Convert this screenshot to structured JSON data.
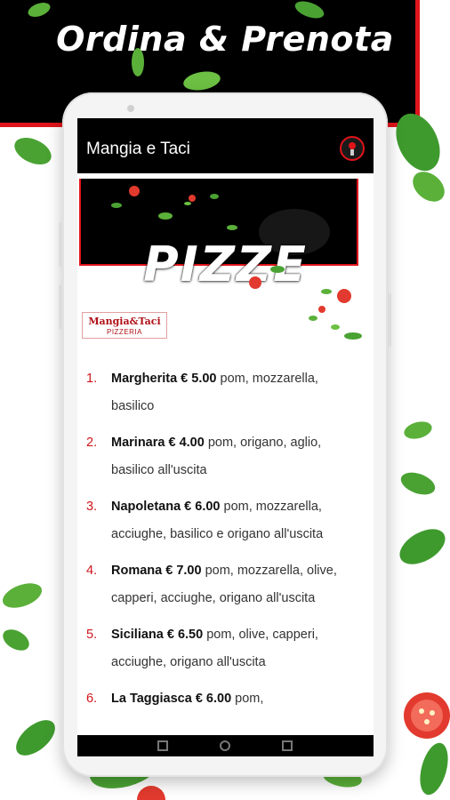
{
  "banner": {
    "title": "Ordina & Prenota"
  },
  "app": {
    "title": "Mangia e Taci"
  },
  "hero": {
    "title": "PIZZE"
  },
  "brand": {
    "name": "Mangia&Taci",
    "sub": "PIZZERIA"
  },
  "menu": [
    {
      "num": "1.",
      "name": "Margherita € 5.00",
      "desc": " pom, mozzarella, basilico"
    },
    {
      "num": "2.",
      "name": "Marinara € 4.00",
      "desc": " pom, origano, aglio, basilico all'uscita"
    },
    {
      "num": "3.",
      "name": "Napoletana € 6.00",
      "desc": " pom, mozzarella, acciughe, basilico e origano all'uscita"
    },
    {
      "num": "4.",
      "name": "Romana € 7.00",
      "desc": " pom, mozzarella, olive, capperi, acciughe, origano all'uscita"
    },
    {
      "num": "5.",
      "name": "Siciliana € 6.50",
      "desc": " pom, olive, capperi, acciughe, origano all'uscita"
    },
    {
      "num": "6.",
      "name": "La Taggiasca € 6.00",
      "desc": " pom,"
    }
  ],
  "colors": {
    "accent": "#e0141b",
    "banner": "#000000",
    "leaf": "#3f9a2e"
  }
}
